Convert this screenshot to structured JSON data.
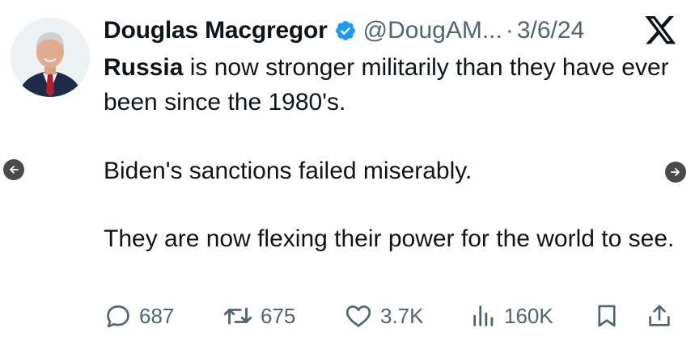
{
  "tweet": {
    "author_name": "Douglas Macgregor",
    "handle": "@DougAM...",
    "separator": "·",
    "date": "3/6/24",
    "text": {
      "bold_lead": "Russia",
      "line1_rest": " is now stronger militarily than they have ever been since the 1980's.",
      "line2": "Biden's sanctions failed miserably.",
      "line3": "They are now flexing their power for the world to see."
    },
    "stats": {
      "replies": "687",
      "reposts": "675",
      "likes": "3.7K",
      "views": "160K"
    }
  },
  "colors": {
    "text": "#0f1419",
    "secondary": "#536471",
    "verified": "#1d9bf0",
    "arrow_bg": "#4a4a4a"
  },
  "icons": [
    "verified-badge-icon",
    "x-logo-icon",
    "reply-icon",
    "repost-icon",
    "like-icon",
    "views-icon",
    "bookmark-icon",
    "share-icon",
    "arrow-left-icon",
    "arrow-right-icon"
  ]
}
